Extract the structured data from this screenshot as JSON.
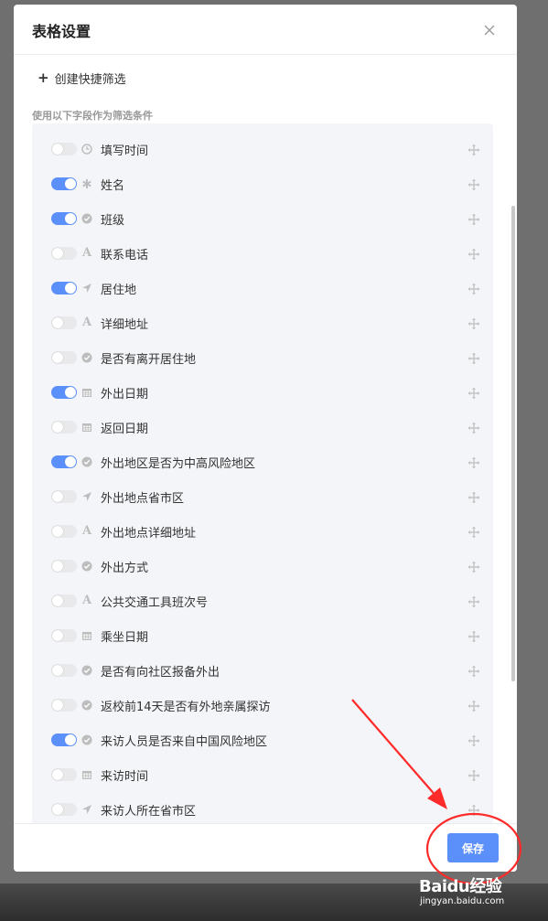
{
  "modal": {
    "title": "表格设置",
    "create_filter_label": "创建快捷筛选",
    "section_label": "使用以下字段作为筛选条件"
  },
  "fields": [
    {
      "label": "填写时间",
      "enabled": false,
      "icon": "clock-icon"
    },
    {
      "label": "姓名",
      "enabled": true,
      "icon": "asterisk-icon"
    },
    {
      "label": "班级",
      "enabled": true,
      "icon": "check-circle-icon"
    },
    {
      "label": "联系电话",
      "enabled": false,
      "icon": "text-icon"
    },
    {
      "label": "居住地",
      "enabled": true,
      "icon": "location-arrow-icon"
    },
    {
      "label": "详细地址",
      "enabled": false,
      "icon": "text-icon"
    },
    {
      "label": "是否有离开居住地",
      "enabled": false,
      "icon": "check-circle-icon"
    },
    {
      "label": "外出日期",
      "enabled": true,
      "icon": "calendar-icon"
    },
    {
      "label": "返回日期",
      "enabled": false,
      "icon": "calendar-icon"
    },
    {
      "label": "外出地区是否为中高风险地区",
      "enabled": true,
      "icon": "check-circle-icon"
    },
    {
      "label": "外出地点省市区",
      "enabled": false,
      "icon": "location-arrow-icon"
    },
    {
      "label": "外出地点详细地址",
      "enabled": false,
      "icon": "text-icon"
    },
    {
      "label": "外出方式",
      "enabled": false,
      "icon": "check-circle-icon"
    },
    {
      "label": "公共交通工具班次号",
      "enabled": false,
      "icon": "text-icon"
    },
    {
      "label": "乘坐日期",
      "enabled": false,
      "icon": "calendar-icon"
    },
    {
      "label": "是否有向社区报备外出",
      "enabled": false,
      "icon": "check-circle-icon"
    },
    {
      "label": "返校前14天是否有外地亲属探访",
      "enabled": false,
      "icon": "check-circle-icon"
    },
    {
      "label": "来访人员是否来自中国风险地区",
      "enabled": true,
      "icon": "check-circle-icon"
    },
    {
      "label": "来访时间",
      "enabled": false,
      "icon": "calendar-icon"
    },
    {
      "label": "来访人所在省市区",
      "enabled": false,
      "icon": "location-arrow-icon"
    }
  ],
  "footer": {
    "save_label": "保存"
  },
  "watermark": {
    "logo": "Baidu经验",
    "url": "jingyan.baidu.com"
  },
  "colors": {
    "accent": "#5b8ff9",
    "annotation": "#ff2a2a",
    "toggle_off": "#e9e9ec"
  }
}
